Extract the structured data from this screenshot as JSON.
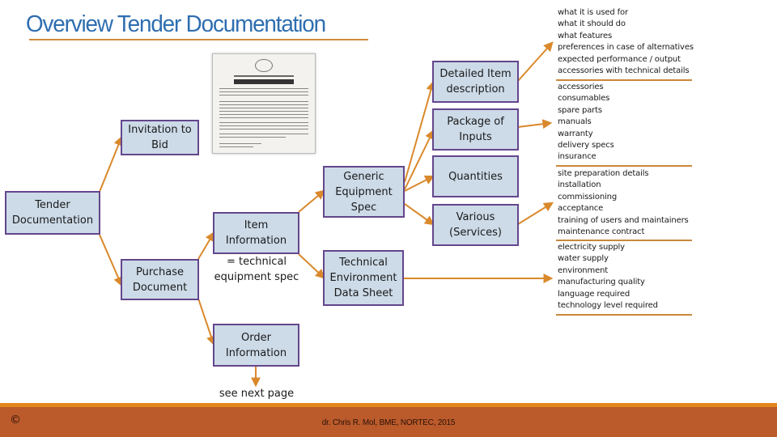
{
  "title": "Overview Tender Documentation",
  "nodes": {
    "tender_documentation": "Tender\nDocumentation",
    "invitation_to_bid": "Invitation to\nBid",
    "purchase_document": "Purchase\nDocument",
    "item_information": "Item\nInformation",
    "item_information_caption": "= technical\nequipment spec",
    "order_information": "Order\nInformation",
    "order_information_caption": "see next page",
    "generic_equipment_spec": "Generic\nEquipment\nSpec",
    "technical_environment_data_sheet": "Technical\nEnvironment\nData Sheet",
    "detailed_item_description": "Detailed Item\ndescription",
    "package_of_inputs": "Package of\nInputs",
    "quantities": "Quantities",
    "various_services": "Various\n(Services)"
  },
  "lists": {
    "detailed_item_description": [
      "what it is used for",
      "what it should do",
      "what features",
      "preferences in case of alternatives",
      "expected performance / output",
      "accessories with technical details"
    ],
    "package_of_inputs": [
      "accessories",
      "consumables",
      "spare parts",
      "manuals",
      "warranty",
      "delivery specs",
      "insurance"
    ],
    "various_services": [
      "site preparation details",
      "installation",
      "commissioning",
      "acceptance",
      "training of users and maintainers",
      "maintenance contract"
    ],
    "technical_environment": [
      "electricity supply",
      "water supply",
      "environment",
      "manufacturing quality",
      "language required",
      "technology level required"
    ]
  },
  "footer": {
    "copyright_symbol": "©",
    "credit": "dr. Chris R. Mol, BME, NORTEC, 2015"
  },
  "colors": {
    "title": "#2e6eb0",
    "box_fill": "#cddbe8",
    "box_border": "#64468c",
    "connector": "#d9892c",
    "footer_bg": "#bb5a2b",
    "footer_stripe": "#e2861e"
  }
}
